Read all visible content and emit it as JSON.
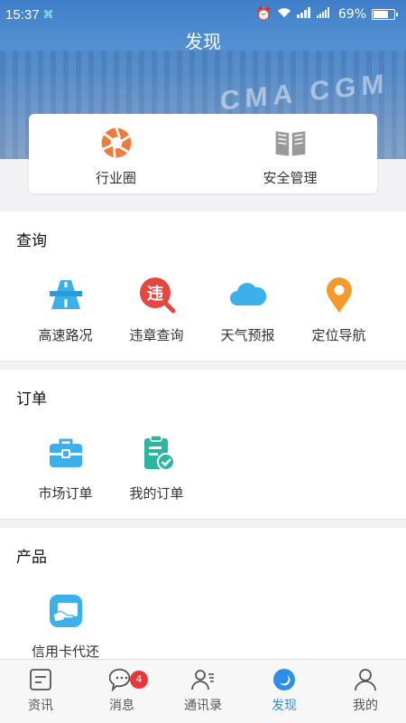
{
  "status_bar": {
    "time": "15:37",
    "battery": "69%"
  },
  "header": {
    "title": "发现",
    "banner_text": "CMA CGM"
  },
  "top_card": {
    "items": [
      {
        "label": "行业圈",
        "icon": "aperture-icon"
      },
      {
        "label": "安全管理",
        "icon": "book-icon"
      }
    ]
  },
  "sections": {
    "query": {
      "title": "查询",
      "items": [
        {
          "label": "高速路况",
          "icon": "highway-icon"
        },
        {
          "label": "违章查询",
          "icon": "violation-search-icon"
        },
        {
          "label": "天气预报",
          "icon": "cloud-icon"
        },
        {
          "label": "定位导航",
          "icon": "location-pin-icon"
        }
      ]
    },
    "orders": {
      "title": "订单",
      "items": [
        {
          "label": "市场订单",
          "icon": "briefcase-icon"
        },
        {
          "label": "我的订单",
          "icon": "clipboard-check-icon"
        }
      ]
    },
    "products": {
      "title": "产品",
      "items": [
        {
          "label": "信用卡代还",
          "icon": "credit-card-hand-icon"
        }
      ]
    }
  },
  "tab_bar": {
    "tabs": [
      {
        "label": "资讯",
        "icon": "news-icon"
      },
      {
        "label": "消息",
        "icon": "chat-icon",
        "badge": "4"
      },
      {
        "label": "通讯录",
        "icon": "contacts-icon"
      },
      {
        "label": "发现",
        "icon": "discover-icon",
        "active": true
      },
      {
        "label": "我的",
        "icon": "profile-icon"
      }
    ]
  },
  "colors": {
    "accent": "#2f8ee8",
    "badge": "#e8363a",
    "orange": "#f07a3a",
    "teal": "#2cb5a0",
    "sky": "#3bb0ea"
  }
}
